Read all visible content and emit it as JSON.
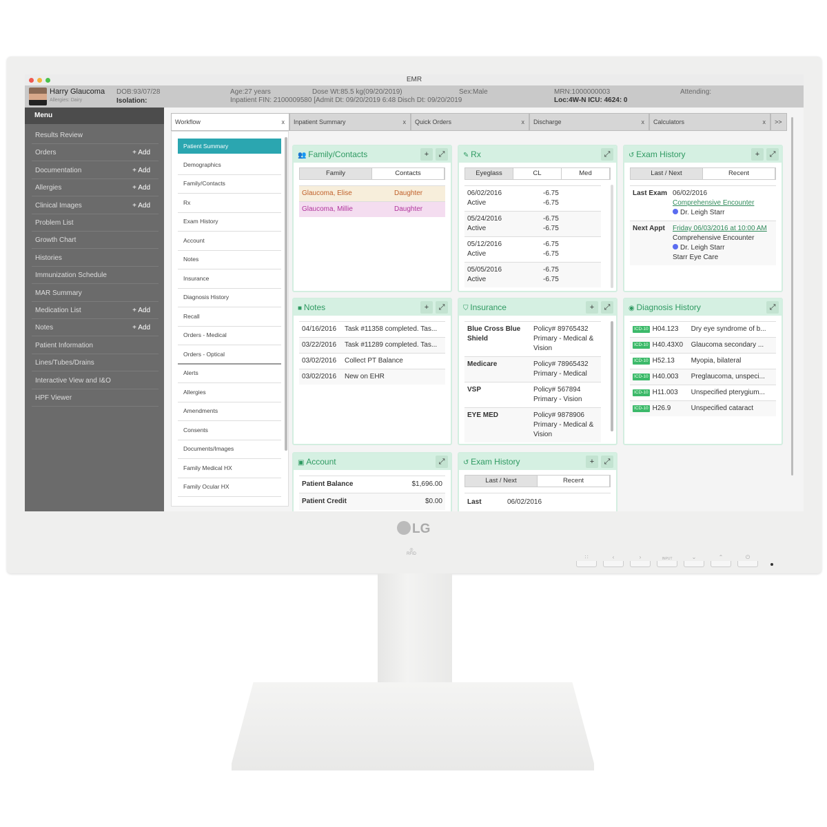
{
  "window": {
    "title": "EMR"
  },
  "patient": {
    "name": "Harry Glaucoma",
    "allergies": "Allergies: Dairy",
    "dob": "DOB:93/07/28",
    "isolation": "Isolation:",
    "age": "Age:27 years",
    "dose_wt": "Dose Wt:85.5 kg(09/20/2019)",
    "fin": "Inpatient FIN: 2100009580 [Admit Dt: 09/20/2019 6:48 Disch Dt: 09/20/2019",
    "sex": "Sex:Male",
    "mrn": "MRN:1000000003",
    "loc": "Loc:4W-N ICU: 4624: 0",
    "attending": "Attending:"
  },
  "sidebar": {
    "header": "Menu",
    "items": [
      {
        "label": "Results Review"
      },
      {
        "label": "Orders",
        "add": "+ Add"
      },
      {
        "label": "Documentation",
        "add": "+ Add"
      },
      {
        "label": "Allergies",
        "add": "+ Add"
      },
      {
        "label": "Clinical Images",
        "add": "+ Add"
      },
      {
        "label": "Problem List"
      },
      {
        "label": "Growth Chart"
      },
      {
        "label": "Histories"
      },
      {
        "label": "Immunization Schedule"
      },
      {
        "label": "MAR Summary"
      },
      {
        "label": "Medication List",
        "add": "+ Add"
      },
      {
        "label": "Notes",
        "add": "+ Add"
      },
      {
        "label": "Patient Information"
      },
      {
        "label": "Lines/Tubes/Drains"
      },
      {
        "label": "Interactive View and I&O"
      },
      {
        "label": "HPF Viewer"
      }
    ]
  },
  "tabs": [
    {
      "label": "Workflow",
      "active": true
    },
    {
      "label": "Inpatient Summary"
    },
    {
      "label": "Quick Orders"
    },
    {
      "label": "Discharge"
    },
    {
      "label": "Calculators"
    }
  ],
  "tabs_more": ">>",
  "tab_close": "x",
  "workflow": [
    "Patient Summary",
    "Demographics",
    "Family/Contacts",
    "Rx",
    "Exam History",
    "Account",
    "Notes",
    "Insurance",
    "Diagnosis History",
    "Recall",
    "Orders - Medical",
    "Orders - Optical",
    "Alerts",
    "Allergies",
    "Amendments",
    "Consents",
    "Documents/Images",
    "Family Medical HX",
    "Family Ocular HX"
  ],
  "cards": {
    "family": {
      "title": "Family/Contacts",
      "icon": "users-icon",
      "tabs": [
        "Family",
        "Contacts"
      ],
      "rows": [
        {
          "name": "Glaucoma, Elise",
          "rel": "Daughter",
          "bg": "#f7eedb",
          "color": "#c0602a"
        },
        {
          "name": "Glaucoma, Millie",
          "rel": "Daughter",
          "bg": "#f4ddf0",
          "color": "#b0359c"
        }
      ]
    },
    "rx": {
      "title": "Rx",
      "icon": "edit-icon",
      "tabs": [
        "Eyeglass",
        "CL",
        "Med"
      ],
      "rows": [
        {
          "date": "06/02/2016",
          "status": "Active",
          "v1": "-6.75",
          "v2": "-6.75"
        },
        {
          "date": "05/24/2016",
          "status": "Active",
          "v1": "-6.75",
          "v2": "-6.75"
        },
        {
          "date": "05/12/2016",
          "status": "Active",
          "v1": "-6.75",
          "v2": "-6.75"
        },
        {
          "date": "05/05/2016",
          "status": "Active",
          "v1": "-6.75",
          "v2": "-6.75"
        }
      ]
    },
    "exam": {
      "title": "Exam History",
      "icon": "history-icon",
      "tabs": [
        "Last / Next",
        "Recent"
      ],
      "last_label": "Last Exam",
      "last_date": "06/02/2016",
      "last_link": "Comprehensive Encounter",
      "last_doctor": "Dr. Leigh Starr",
      "next_label": "Next Appt",
      "next_link": "Friday 06/03/2016 at 10:00 AM",
      "next_type": "Comprehensive Encounter",
      "next_doctor": "Dr. Leigh Starr",
      "next_location": "Starr Eye Care"
    },
    "notes": {
      "title": "Notes",
      "icon": "note-icon",
      "rows": [
        {
          "date": "04/16/2016",
          "text": "Task #11358 completed. Tas..."
        },
        {
          "date": "03/22/2016",
          "text": "Task #11289 completed. Tas..."
        },
        {
          "date": "03/02/2016",
          "text": "Collect PT Balance"
        },
        {
          "date": "03/02/2016",
          "text": "New on EHR"
        }
      ]
    },
    "insurance": {
      "title": "Insurance",
      "icon": "shield-icon",
      "rows": [
        {
          "name": "Blue Cross Blue Shield",
          "policy": "Policy# 89765432",
          "type": "Primary - Medical & Vision"
        },
        {
          "name": "Medicare",
          "policy": "Policy# 78965432",
          "type": "Primary - Medical"
        },
        {
          "name": "VSP",
          "policy": "Policy# 567894",
          "type": "Primary - Vision"
        },
        {
          "name": "EYE MED",
          "policy": "Policy# 9878906",
          "type": "Primary - Medical & Vision"
        }
      ]
    },
    "diagnosis": {
      "title": "Diagnosis History",
      "icon": "eye-icon",
      "badge": "ICD-10",
      "rows": [
        {
          "code": "H04.123",
          "desc": "Dry eye syndrome of b..."
        },
        {
          "code": "H40.43X0",
          "desc": "Glaucoma secondary ..."
        },
        {
          "code": "H52.13",
          "desc": "Myopia, bilateral"
        },
        {
          "code": "H40.003",
          "desc": "Preglaucoma, unspeci..."
        },
        {
          "code": "H11.003",
          "desc": "Unspecified pterygium..."
        },
        {
          "code": "H26.9",
          "desc": "Unspecified cataract"
        }
      ]
    },
    "account": {
      "title": "Account",
      "icon": "money-icon",
      "rows": [
        {
          "label": "Patient Balance",
          "value": "$1,696.00"
        },
        {
          "label": "Patient Credit",
          "value": "$0.00"
        }
      ]
    },
    "exam2": {
      "title": "Exam History",
      "icon": "history-icon",
      "tabs": [
        "Last / Next",
        "Recent"
      ],
      "last_label": "Last",
      "last_date": "06/02/2016"
    }
  },
  "buttons": {
    "add": "+",
    "expand": "⤢"
  },
  "monitor": {
    "brand": "LG",
    "rfid": "RFID",
    "controls": [
      "menu",
      "<",
      ">",
      "INPUT",
      "v",
      "^",
      "power"
    ]
  },
  "colors": {
    "accent": "#2ba6b0",
    "card_header": "#d5f0e2",
    "card_title": "#2f9a62",
    "sidebar": "#6b6b6b",
    "badge": "#3cb96a"
  }
}
